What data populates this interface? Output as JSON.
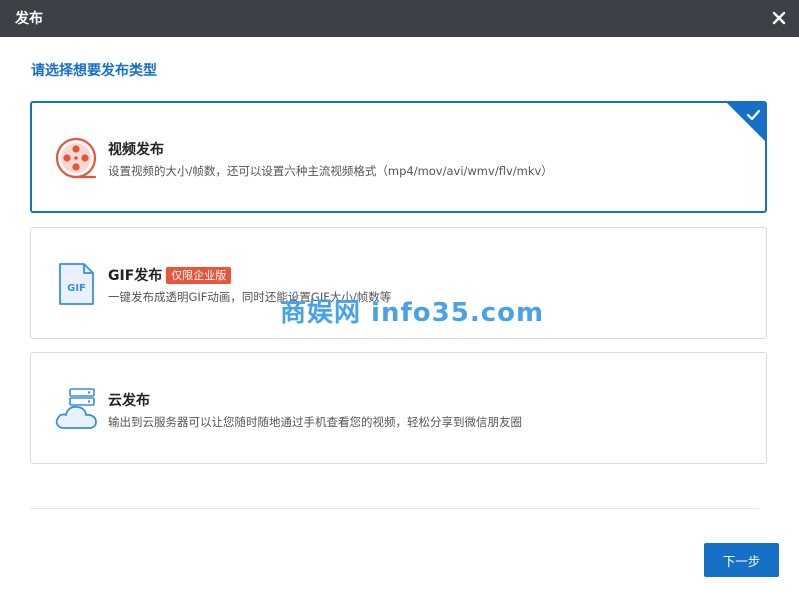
{
  "window": {
    "title": "发布",
    "close_icon": "close-icon"
  },
  "prompt": "请选择想要发布类型",
  "options": [
    {
      "name": "视频发布",
      "desc": "设置视频的大小/帧数，还可以设置六种主流视频格式（mp4/mov/avi/wmv/flv/mkv）",
      "icon": "film-reel-icon",
      "selected": true
    },
    {
      "name": "GIF发布",
      "badge": "仅限企业版",
      "desc": "一键发布成透明GIF动画，同时还能设置GIF大小/帧数等",
      "icon": "gif-file-icon",
      "icon_text": "GIF",
      "selected": false
    },
    {
      "name": "云发布",
      "desc": "输出到云服务器可以让您随时随地通过手机查看您的视频，轻松分享到微信朋友圈",
      "icon": "cloud-server-icon",
      "selected": false
    }
  ],
  "next_button": "下一步",
  "watermark": "商娱网 info35.com",
  "colors": {
    "titlebar": "#3d4047",
    "accent": "#1670c8",
    "badge": "#e8543c",
    "video_icon": "#e8543c",
    "icon_blue": "#3a8ee0"
  }
}
